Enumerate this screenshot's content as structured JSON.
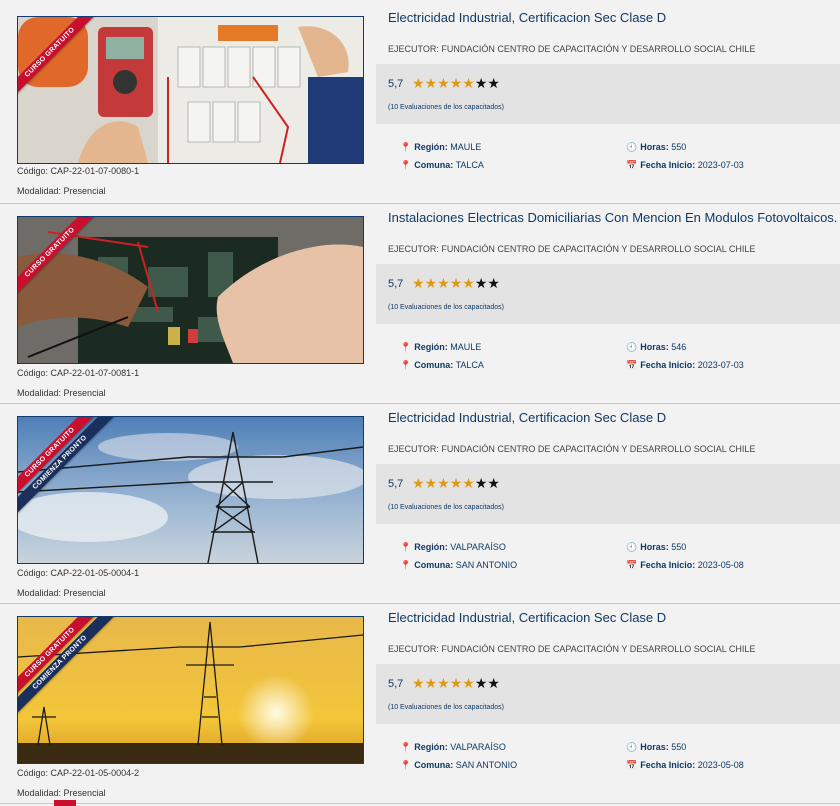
{
  "labels": {
    "codigo": "Código:",
    "modalidad": "Modalidad:",
    "region": "Región:",
    "comuna": "Comuna:",
    "horas": "Horas:",
    "fecha": "Fecha Inicio:"
  },
  "icons": {
    "region": "map-marker-icon",
    "comuna": "map-marker-icon",
    "horas": "clock-icon",
    "fecha": "calendar-icon"
  },
  "colors": {
    "title": "#0e3a66",
    "star_filled": "#e09a1a",
    "ribbon_gratuito": "#c8102e",
    "ribbon_pronto": "#1b2f5c"
  },
  "courses": [
    {
      "ribbons": [
        "CURSO GRATUITO"
      ],
      "code": "CAP-22-01-07-0080-1",
      "modalidad": "Presencial",
      "title": "Electricidad Industrial, Certificacion Sec Clase D",
      "ejecutor": "EJECUTOR: FUNDACIÓN CENTRO DE CAPACITACIÓN Y DESARROLLO SOCIAL CHILE",
      "score": "5,7",
      "stars_filled": 5,
      "stars_total": 7,
      "evaluaciones": "(10 Evaluaciones de los capacitados)",
      "region": "MAULE",
      "comuna": "TALCA",
      "horas": "550",
      "fecha": "2023-07-03",
      "image": "electrician-panel"
    },
    {
      "ribbons": [
        "CURSO GRATUITO"
      ],
      "code": "CAP-22-01-07-0081-1",
      "modalidad": "Presencial",
      "title": "Instalaciones Electricas Domiciliarias Con Mencion En Modulos Fotovoltaicos.",
      "ejecutor": "EJECUTOR: FUNDACIÓN CENTRO DE CAPACITACIÓN Y DESARROLLO SOCIAL CHILE",
      "score": "5,7",
      "stars_filled": 5,
      "stars_total": 7,
      "evaluaciones": "(10 Evaluaciones de los capacitados)",
      "region": "MAULE",
      "comuna": "TALCA",
      "horas": "546",
      "fecha": "2023-07-03",
      "image": "circuit-board"
    },
    {
      "ribbons": [
        "CURSO GRATUITO",
        "COMIENZA PRONTO"
      ],
      "code": "CAP-22-01-05-0004-1",
      "modalidad": "Presencial",
      "title": "Electricidad Industrial, Certificacion Sec Clase D",
      "ejecutor": "EJECUTOR: FUNDACIÓN CENTRO DE CAPACITACIÓN Y DESARROLLO SOCIAL CHILE",
      "score": "5,7",
      "stars_filled": 5,
      "stars_total": 7,
      "evaluaciones": "(10 Evaluaciones de los capacitados)",
      "region": "VALPARAÍSO",
      "comuna": "SAN ANTONIO",
      "horas": "550",
      "fecha": "2023-05-08",
      "image": "power-tower-sky"
    },
    {
      "ribbons": [
        "CURSO GRATUITO",
        "COMIENZA PRONTO"
      ],
      "code": "CAP-22-01-05-0004-2",
      "modalidad": "Presencial",
      "title": "Electricidad Industrial, Certificacion Sec Clase D",
      "ejecutor": "EJECUTOR: FUNDACIÓN CENTRO DE CAPACITACIÓN Y DESARROLLO SOCIAL CHILE",
      "score": "5,7",
      "stars_filled": 5,
      "stars_total": 7,
      "evaluaciones": "(10 Evaluaciones de los capacitados)",
      "region": "VALPARAÍSO",
      "comuna": "SAN ANTONIO",
      "horas": "550",
      "fecha": "2023-05-08",
      "image": "power-tower-sunset"
    }
  ]
}
